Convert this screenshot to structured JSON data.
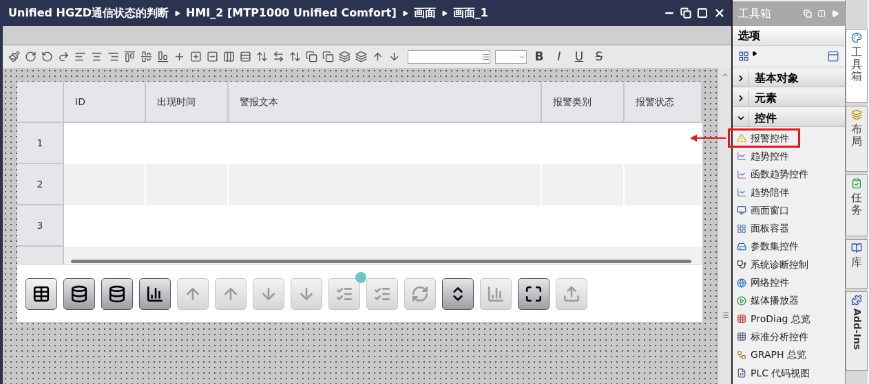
{
  "editor": {
    "breadcrumb": [
      "Unified HGZD通信状态的判断",
      "HMI_2 [MTP1000 Unified Comfort]",
      "画面",
      "画面_1"
    ],
    "format_buttons": [
      {
        "label": "B",
        "kind": "bold"
      },
      {
        "label": "I",
        "kind": "italic"
      },
      {
        "label": "U",
        "kind": "underline"
      },
      {
        "label": "S",
        "kind": "strike"
      }
    ],
    "alarm_table": {
      "columns": [
        "",
        "ID",
        "出现时间",
        "警报文本",
        "报警类别",
        "报警状态"
      ],
      "rows": [
        {
          "label": "1"
        },
        {
          "label": "2"
        },
        {
          "label": "3"
        }
      ]
    },
    "alarm_toolbar": [
      {
        "disabled": false,
        "pressed": true,
        "indicator": false
      },
      {
        "disabled": false,
        "pressed": false,
        "indicator": false
      },
      {
        "disabled": false,
        "pressed": false,
        "indicator": false
      },
      {
        "disabled": false,
        "pressed": false,
        "indicator": false
      },
      {
        "disabled": true,
        "pressed": false,
        "indicator": false
      },
      {
        "disabled": true,
        "pressed": false,
        "indicator": false
      },
      {
        "disabled": true,
        "pressed": false,
        "indicator": false
      },
      {
        "disabled": true,
        "pressed": false,
        "indicator": false
      },
      {
        "disabled": true,
        "pressed": false,
        "indicator": true
      },
      {
        "disabled": true,
        "pressed": false,
        "indicator": false
      },
      {
        "disabled": true,
        "pressed": false,
        "indicator": false
      },
      {
        "disabled": false,
        "pressed": false,
        "indicator": false
      },
      {
        "disabled": true,
        "pressed": false,
        "indicator": false
      },
      {
        "disabled": false,
        "pressed": false,
        "indicator": false
      },
      {
        "disabled": true,
        "pressed": false,
        "indicator": false
      }
    ]
  },
  "toolbox": {
    "title": "工具箱",
    "options_label": "选项",
    "sections": [
      {
        "label": "基本对象",
        "expanded": false
      },
      {
        "label": "元素",
        "expanded": false
      },
      {
        "label": "控件",
        "expanded": true
      }
    ],
    "items": [
      {
        "label": "报警控件",
        "highlighted": true
      },
      {
        "label": "趋势控件",
        "highlighted": false
      },
      {
        "label": "函数趋势控件",
        "highlighted": false
      },
      {
        "label": "趋势陪伴",
        "highlighted": false
      },
      {
        "label": "画面窗口",
        "highlighted": false
      },
      {
        "label": "面板容器",
        "highlighted": false
      },
      {
        "label": "参数集控件",
        "highlighted": false
      },
      {
        "label": "系统诊断控制",
        "highlighted": false
      },
      {
        "label": "网络控件",
        "highlighted": false
      },
      {
        "label": "媒体播放器",
        "highlighted": false
      },
      {
        "label": "ProDiag 总览",
        "highlighted": false
      },
      {
        "label": "标准分析控件",
        "highlighted": false
      },
      {
        "label": "GRAPH 总览",
        "highlighted": false
      },
      {
        "label": "PLC 代码视图",
        "highlighted": false
      }
    ]
  },
  "side_tabs": [
    {
      "label": "工具箱",
      "selected": true,
      "kind": "cjk"
    },
    {
      "label": "布局",
      "selected": false,
      "kind": "cjk"
    },
    {
      "label": "任务",
      "selected": false,
      "kind": "cjk"
    },
    {
      "label": "库",
      "selected": false,
      "kind": "cjk"
    },
    {
      "label": "Add-Ins",
      "selected": false,
      "kind": "latin"
    }
  ]
}
